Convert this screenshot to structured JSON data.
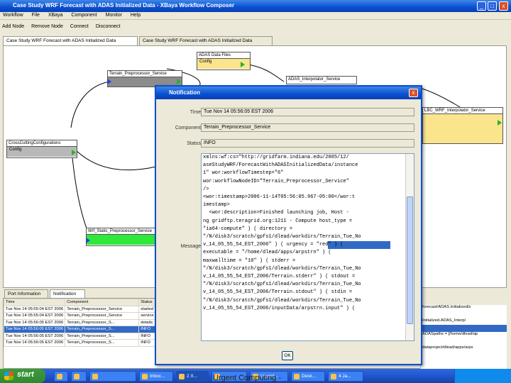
{
  "window": {
    "title": "Case Study WRF Forecast with ADAS Initialized Data - XBaya Workflow Composer",
    "min_label": "_",
    "max_label": "□",
    "close_label": "x"
  },
  "menu": [
    "Workflow",
    "File",
    "XBaya",
    "Component",
    "Monitor",
    "Help"
  ],
  "toolbar": [
    "Add Node",
    "Remove Node",
    "Connect",
    "Disconnect"
  ],
  "tabs": [
    "Case Study WRF Forecast with ADAS Initialized Data",
    "Case Study WRF Forecast with ADAS Initialized Data"
  ],
  "nodes": {
    "adas_datafiles": {
      "title": "ADAS Data Files",
      "body": "Config"
    },
    "terrain": {
      "title": "Terrain_Preprocessor_Service",
      "body": ""
    },
    "adas_interp": {
      "title": "ADAS_Interpolator_Service",
      "body": ""
    },
    "lbc_interp": {
      "title": "LBC_WRF_Interpolator_Service",
      "body": ""
    },
    "crossgrid": {
      "title": "CrossCuttingConfigurations",
      "body": "Config"
    },
    "wrf_static": {
      "title": "Wrf_Static_Preprocessor_Service",
      "body": ""
    }
  },
  "lower_tabs": [
    "Port Information",
    "Notification"
  ],
  "table": {
    "headers": [
      "Time",
      "Component",
      "Status"
    ],
    "rows": [
      [
        "Tue Nov 14 05:55:04 EST 2006",
        "Terrain_Preprocessor_Service",
        "started"
      ],
      [
        "Tue Nov 14 05:55:04 EST 2006",
        "Terrain_Preprocessor_Service",
        "service"
      ],
      [
        "Tue Nov 14 05:56:05 EST 2006",
        "Terrain_Preprocessor_S...",
        "details"
      ],
      [
        "Tue Nov 14 05:56:05 EST 2006",
        "Terrain_Preprocessor_S...",
        "INFO"
      ],
      [
        "Tue Nov 14 05:56:05 EST 2006",
        "Terrain_Preprocessor_S...",
        "INFO"
      ],
      [
        "Tue Nov 14 05:56:05 EST 2006",
        "Terrain_Preprocessor_S...",
        "INFO"
      ]
    ],
    "selected_row": 3,
    "right_column": [
      "forecast/ADAS.Initialized/s",
      "",
      "Initialized.ADAS_Interp/",
      "",
      "ADASpaths = [/home/dlead/ap",
      "",
      "dataproject/dlead/apps/arps"
    ]
  },
  "dialog": {
    "title": "Notification",
    "close_label": "x",
    "time_label": "Time:",
    "time_value": "Tue Nov 14 05:56:05 EST 2006",
    "component_label": "Component:",
    "component_value": "Terrain_Preprocessor_Service",
    "status_label": "Status:",
    "status_value": "INFO",
    "message_label": "Message:",
    "message_lines": [
      "xmlns:wf:cs=\"http://gridfarm.indiana.edu/2005/12/",
      "aseStudyWRF/ForecastWithADASInitializedData/instance",
      "1\" wor:workflowTimestep=\"6\"",
      "wor:workflowNodeID=\"Terrain_Preprocessor_Service\"",
      "/>",
      "",
      "<wor:timestamp>2006-11-14T05:56:05.967-05:00</wor:t",
      "imestamp>",
      "  <wor:description>Finished launching job, Host -",
      "ng gridftp.teragrid.org:1211 - Compute host_type =",
      "\"ia64-compute\" ) ( directory =",
      "\"/N/disk3/scratch/gpfs1/dlead/workdirs/Terrain_Tue_No",
      "v_14_05_55_54_EST_2006\" ) ( urgency = \"red\" ) (",
      "executable = \"/home/dlead/apps/arpstrn\" ) (",
      "maxwalltime = \"10\" ) ( stderr =",
      "\"/N/disk3/scratch/gpfs1/dlead/workdirs/Terrain_Tue_No",
      "v_14_05_55_54_EST_2006/Terrain.stderr\" ) ( stdout =",
      "\"/N/disk3/scratch/gpfs1/dlead/workdirs/Terrain_Tue_No",
      "v_14_05_55_54_EST_2006/Terrain.stdout\" ) ( stdin =",
      "\"/N/disk3/scratch/gpfs1/dlead/workdirs/Terrain_Tue_No",
      "v_14_05_55_54_EST_2006/inputData/arpstrn.input\" ) ("
    ],
    "ok_label": "OK"
  },
  "taskbar": {
    "start_label": "start",
    "buttons": [
      "",
      "",
      "",
      "Inbox...",
      "2 X...",
      "",
      "Urgent...",
      "Desk...",
      "4 Ja..."
    ]
  },
  "footer": "Urgent Computing -"
}
